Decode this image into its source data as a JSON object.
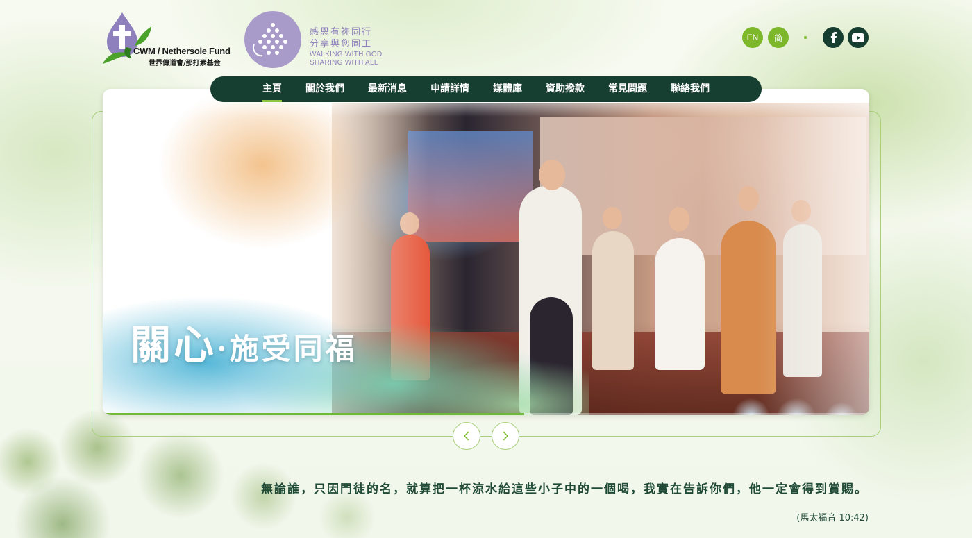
{
  "header": {
    "cwm_logo": {
      "name_en": "CWM / Nethersole Fund",
      "name_zh": "世界傳道會/那打素基金"
    },
    "campaign_logo": {
      "line1_zh": "感恩有祢同行",
      "line2_zh": "分享與您同工",
      "line1_en": "WALKING  WITH GOD",
      "line2_en": "SHARING WITH ALL"
    },
    "lang": {
      "en": "EN",
      "sc": "简"
    },
    "social": {
      "facebook": "facebook-icon",
      "youtube": "youtube-icon"
    }
  },
  "nav": {
    "items": [
      {
        "label": "主頁",
        "active": true
      },
      {
        "label": "關於我們",
        "active": false
      },
      {
        "label": "最新消息",
        "active": false
      },
      {
        "label": "申請詳情",
        "active": false
      },
      {
        "label": "媒體庫",
        "active": false
      },
      {
        "label": "資助撥款",
        "active": false
      },
      {
        "label": "常見問題",
        "active": false
      },
      {
        "label": "聯絡我們",
        "active": false
      }
    ]
  },
  "hero": {
    "caption_main": "關心",
    "caption_dot": "·",
    "caption_rest": "施受同福",
    "progress": 0.55,
    "prev_icon": "chevron-left-icon",
    "next_icon": "chevron-right-icon"
  },
  "verse": {
    "text": "無論誰，只因門徒的名，就算把一杯涼水給這些小子中的一個喝，我實在告訴你們，他一定會得到賞賜。",
    "ref": "(馬太福音 10:42)"
  },
  "colors": {
    "nav_bg": "#173f31",
    "accent_green": "#7cb82a",
    "purple": "#8f7fbb",
    "text_dark_green": "#1f4a36"
  }
}
